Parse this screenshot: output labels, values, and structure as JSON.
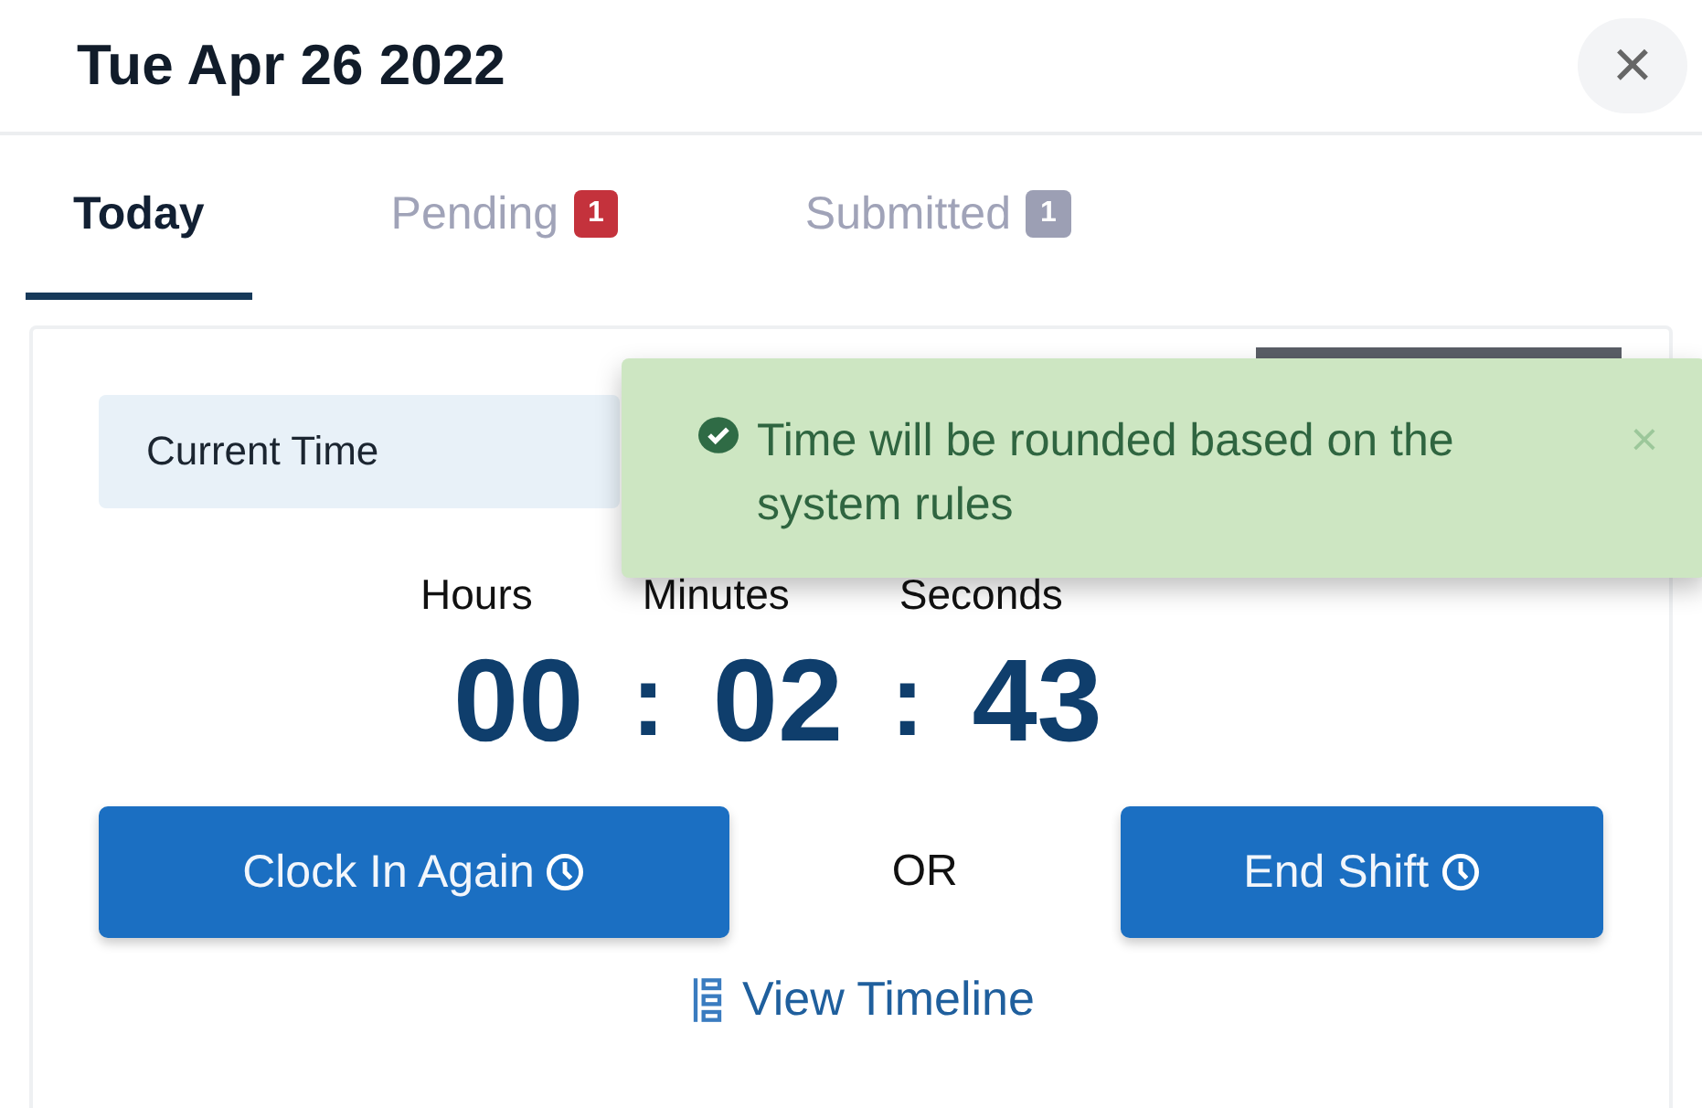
{
  "header": {
    "title": "Tue Apr 26 2022",
    "close": "×"
  },
  "tabs": [
    {
      "label": "Today",
      "selected": true
    },
    {
      "label": "Pending",
      "selected": false,
      "badge": "1",
      "color": "#c4323c"
    },
    {
      "label": "Submitted",
      "selected": false,
      "badge": "1",
      "color": "#9c9fb4"
    }
  ],
  "current_time": {
    "label": "Current Time"
  },
  "toast": {
    "message": "Time will be rounded based on the system rules",
    "close": "×"
  },
  "timer": {
    "units": [
      "Hours",
      "Minutes",
      "Seconds"
    ],
    "values": [
      "00",
      "02",
      "43"
    ],
    "separator": ":"
  },
  "actions": {
    "clock_in": "Clock In Again",
    "or": "OR",
    "end_shift": "End Shift"
  },
  "timeline_link": "View Timeline"
}
